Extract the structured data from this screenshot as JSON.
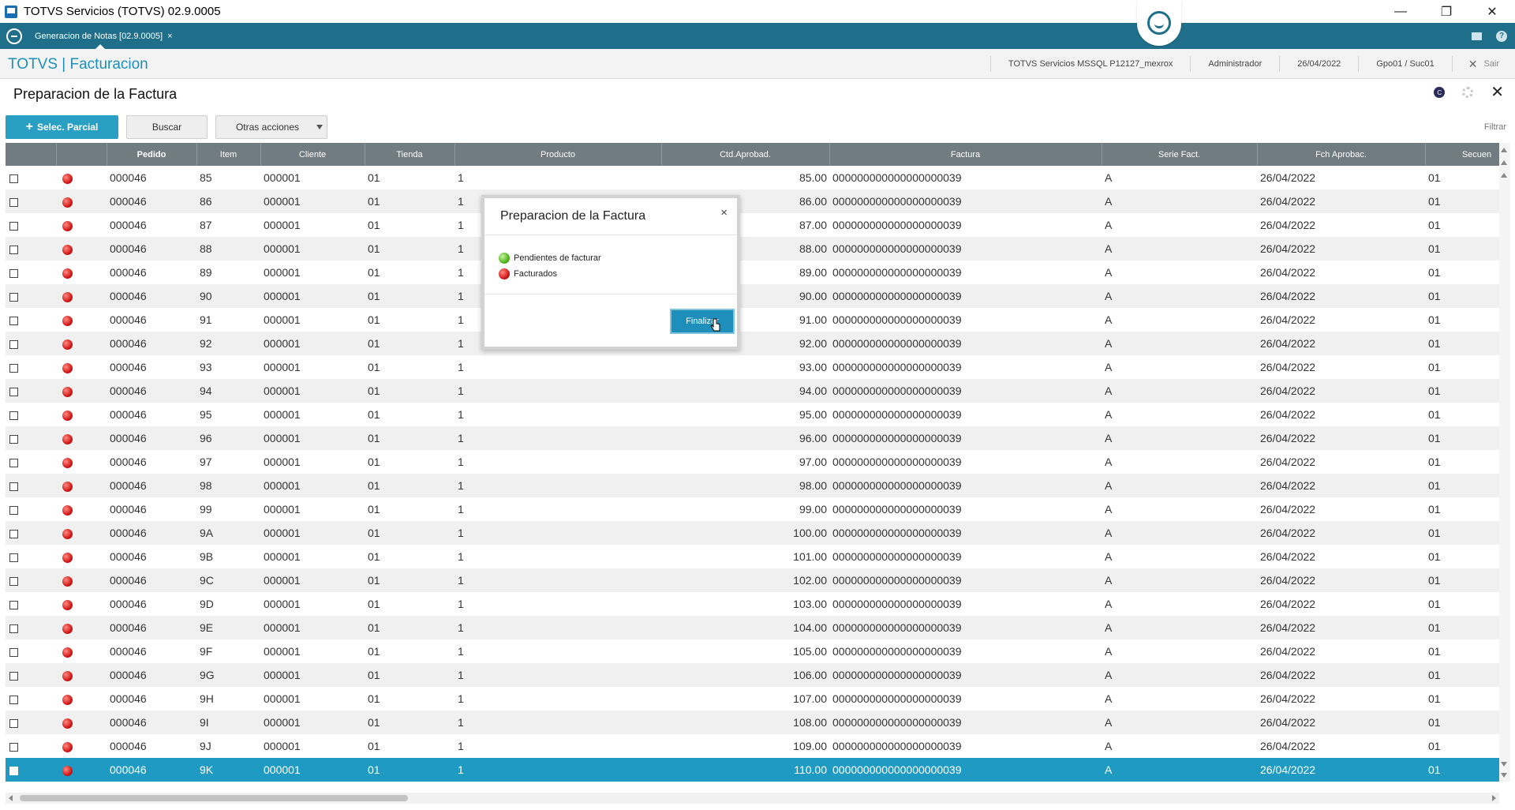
{
  "window": {
    "title": "TOTVS Servicios (TOTVS) 02.9.0005",
    "min": "—",
    "max": "❐",
    "close": "✕"
  },
  "tabbar": {
    "tab_label": "Generacion de Notas [02.9.0005]",
    "tab_close": "×",
    "help": "?"
  },
  "header": {
    "app_title": "TOTVS | Facturacion",
    "environment": "TOTVS Servicios MSSQL P12127_mexrox",
    "user": "Administrador",
    "date": "26/04/2022",
    "branch": "Gpo01 / Suc01",
    "exit_label": "Sair",
    "exit_icon": "✕"
  },
  "page": {
    "title": "Preparacion de la Factura",
    "c_icon": "C",
    "close_icon": "✕"
  },
  "toolbar": {
    "selec_parcial": "Selec. Parcial",
    "buscar": "Buscar",
    "otras_acciones": "Otras acciones",
    "filtrar": "Filtrar"
  },
  "grid": {
    "columns": [
      "",
      "",
      "Pedido",
      "Item",
      "Cliente",
      "Tienda",
      "Producto",
      "Ctd.Aprobad.",
      "Factura",
      "Serie Fact.",
      "Fch Aprobac.",
      "Secuen"
    ],
    "rows": [
      {
        "pedido": "000046",
        "item": "85",
        "cliente": "000001",
        "tienda": "01",
        "producto": "1",
        "ctd": "85.00",
        "factura": "000000000000000000039",
        "serie": "A",
        "fecha": "26/04/2022",
        "sec": "01"
      },
      {
        "pedido": "000046",
        "item": "86",
        "cliente": "000001",
        "tienda": "01",
        "producto": "1",
        "ctd": "86.00",
        "factura": "000000000000000000039",
        "serie": "A",
        "fecha": "26/04/2022",
        "sec": "01"
      },
      {
        "pedido": "000046",
        "item": "87",
        "cliente": "000001",
        "tienda": "01",
        "producto": "1",
        "ctd": "87.00",
        "factura": "000000000000000000039",
        "serie": "A",
        "fecha": "26/04/2022",
        "sec": "01"
      },
      {
        "pedido": "000046",
        "item": "88",
        "cliente": "000001",
        "tienda": "01",
        "producto": "1",
        "ctd": "88.00",
        "factura": "000000000000000000039",
        "serie": "A",
        "fecha": "26/04/2022",
        "sec": "01"
      },
      {
        "pedido": "000046",
        "item": "89",
        "cliente": "000001",
        "tienda": "01",
        "producto": "1",
        "ctd": "89.00",
        "factura": "000000000000000000039",
        "serie": "A",
        "fecha": "26/04/2022",
        "sec": "01"
      },
      {
        "pedido": "000046",
        "item": "90",
        "cliente": "000001",
        "tienda": "01",
        "producto": "1",
        "ctd": "90.00",
        "factura": "000000000000000000039",
        "serie": "A",
        "fecha": "26/04/2022",
        "sec": "01"
      },
      {
        "pedido": "000046",
        "item": "91",
        "cliente": "000001",
        "tienda": "01",
        "producto": "1",
        "ctd": "91.00",
        "factura": "000000000000000000039",
        "serie": "A",
        "fecha": "26/04/2022",
        "sec": "01"
      },
      {
        "pedido": "000046",
        "item": "92",
        "cliente": "000001",
        "tienda": "01",
        "producto": "1",
        "ctd": "92.00",
        "factura": "000000000000000000039",
        "serie": "A",
        "fecha": "26/04/2022",
        "sec": "01"
      },
      {
        "pedido": "000046",
        "item": "93",
        "cliente": "000001",
        "tienda": "01",
        "producto": "1",
        "ctd": "93.00",
        "factura": "000000000000000000039",
        "serie": "A",
        "fecha": "26/04/2022",
        "sec": "01"
      },
      {
        "pedido": "000046",
        "item": "94",
        "cliente": "000001",
        "tienda": "01",
        "producto": "1",
        "ctd": "94.00",
        "factura": "000000000000000000039",
        "serie": "A",
        "fecha": "26/04/2022",
        "sec": "01"
      },
      {
        "pedido": "000046",
        "item": "95",
        "cliente": "000001",
        "tienda": "01",
        "producto": "1",
        "ctd": "95.00",
        "factura": "000000000000000000039",
        "serie": "A",
        "fecha": "26/04/2022",
        "sec": "01"
      },
      {
        "pedido": "000046",
        "item": "96",
        "cliente": "000001",
        "tienda": "01",
        "producto": "1",
        "ctd": "96.00",
        "factura": "000000000000000000039",
        "serie": "A",
        "fecha": "26/04/2022",
        "sec": "01"
      },
      {
        "pedido": "000046",
        "item": "97",
        "cliente": "000001",
        "tienda": "01",
        "producto": "1",
        "ctd": "97.00",
        "factura": "000000000000000000039",
        "serie": "A",
        "fecha": "26/04/2022",
        "sec": "01"
      },
      {
        "pedido": "000046",
        "item": "98",
        "cliente": "000001",
        "tienda": "01",
        "producto": "1",
        "ctd": "98.00",
        "factura": "000000000000000000039",
        "serie": "A",
        "fecha": "26/04/2022",
        "sec": "01"
      },
      {
        "pedido": "000046",
        "item": "99",
        "cliente": "000001",
        "tienda": "01",
        "producto": "1",
        "ctd": "99.00",
        "factura": "000000000000000000039",
        "serie": "A",
        "fecha": "26/04/2022",
        "sec": "01"
      },
      {
        "pedido": "000046",
        "item": "9A",
        "cliente": "000001",
        "tienda": "01",
        "producto": "1",
        "ctd": "100.00",
        "factura": "000000000000000000039",
        "serie": "A",
        "fecha": "26/04/2022",
        "sec": "01"
      },
      {
        "pedido": "000046",
        "item": "9B",
        "cliente": "000001",
        "tienda": "01",
        "producto": "1",
        "ctd": "101.00",
        "factura": "000000000000000000039",
        "serie": "A",
        "fecha": "26/04/2022",
        "sec": "01"
      },
      {
        "pedido": "000046",
        "item": "9C",
        "cliente": "000001",
        "tienda": "01",
        "producto": "1",
        "ctd": "102.00",
        "factura": "000000000000000000039",
        "serie": "A",
        "fecha": "26/04/2022",
        "sec": "01"
      },
      {
        "pedido": "000046",
        "item": "9D",
        "cliente": "000001",
        "tienda": "01",
        "producto": "1",
        "ctd": "103.00",
        "factura": "000000000000000000039",
        "serie": "A",
        "fecha": "26/04/2022",
        "sec": "01"
      },
      {
        "pedido": "000046",
        "item": "9E",
        "cliente": "000001",
        "tienda": "01",
        "producto": "1",
        "ctd": "104.00",
        "factura": "000000000000000000039",
        "serie": "A",
        "fecha": "26/04/2022",
        "sec": "01"
      },
      {
        "pedido": "000046",
        "item": "9F",
        "cliente": "000001",
        "tienda": "01",
        "producto": "1",
        "ctd": "105.00",
        "factura": "000000000000000000039",
        "serie": "A",
        "fecha": "26/04/2022",
        "sec": "01"
      },
      {
        "pedido": "000046",
        "item": "9G",
        "cliente": "000001",
        "tienda": "01",
        "producto": "1",
        "ctd": "106.00",
        "factura": "000000000000000000039",
        "serie": "A",
        "fecha": "26/04/2022",
        "sec": "01"
      },
      {
        "pedido": "000046",
        "item": "9H",
        "cliente": "000001",
        "tienda": "01",
        "producto": "1",
        "ctd": "107.00",
        "factura": "000000000000000000039",
        "serie": "A",
        "fecha": "26/04/2022",
        "sec": "01"
      },
      {
        "pedido": "000046",
        "item": "9I",
        "cliente": "000001",
        "tienda": "01",
        "producto": "1",
        "ctd": "108.00",
        "factura": "000000000000000000039",
        "serie": "A",
        "fecha": "26/04/2022",
        "sec": "01"
      },
      {
        "pedido": "000046",
        "item": "9J",
        "cliente": "000001",
        "tienda": "01",
        "producto": "1",
        "ctd": "109.00",
        "factura": "000000000000000000039",
        "serie": "A",
        "fecha": "26/04/2022",
        "sec": "01"
      },
      {
        "pedido": "000046",
        "item": "9K",
        "cliente": "000001",
        "tienda": "01",
        "producto": "1",
        "ctd": "110.00",
        "factura": "000000000000000000039",
        "serie": "A",
        "fecha": "26/04/2022",
        "sec": "01"
      }
    ],
    "selected_row_index": 25
  },
  "modal": {
    "title": "Preparacion de la Factura",
    "close": "×",
    "legend": [
      {
        "label": "Pendientes de facturar",
        "color": "#4fb51d"
      },
      {
        "label": "Facturados",
        "color": "#d11a1a"
      }
    ],
    "button": "Finalizar"
  },
  "colors": {
    "accent": "#1d8fba",
    "tabbar": "#1f6f8b",
    "selected_row": "#1f9bc3",
    "grid_header": "#707b82"
  }
}
